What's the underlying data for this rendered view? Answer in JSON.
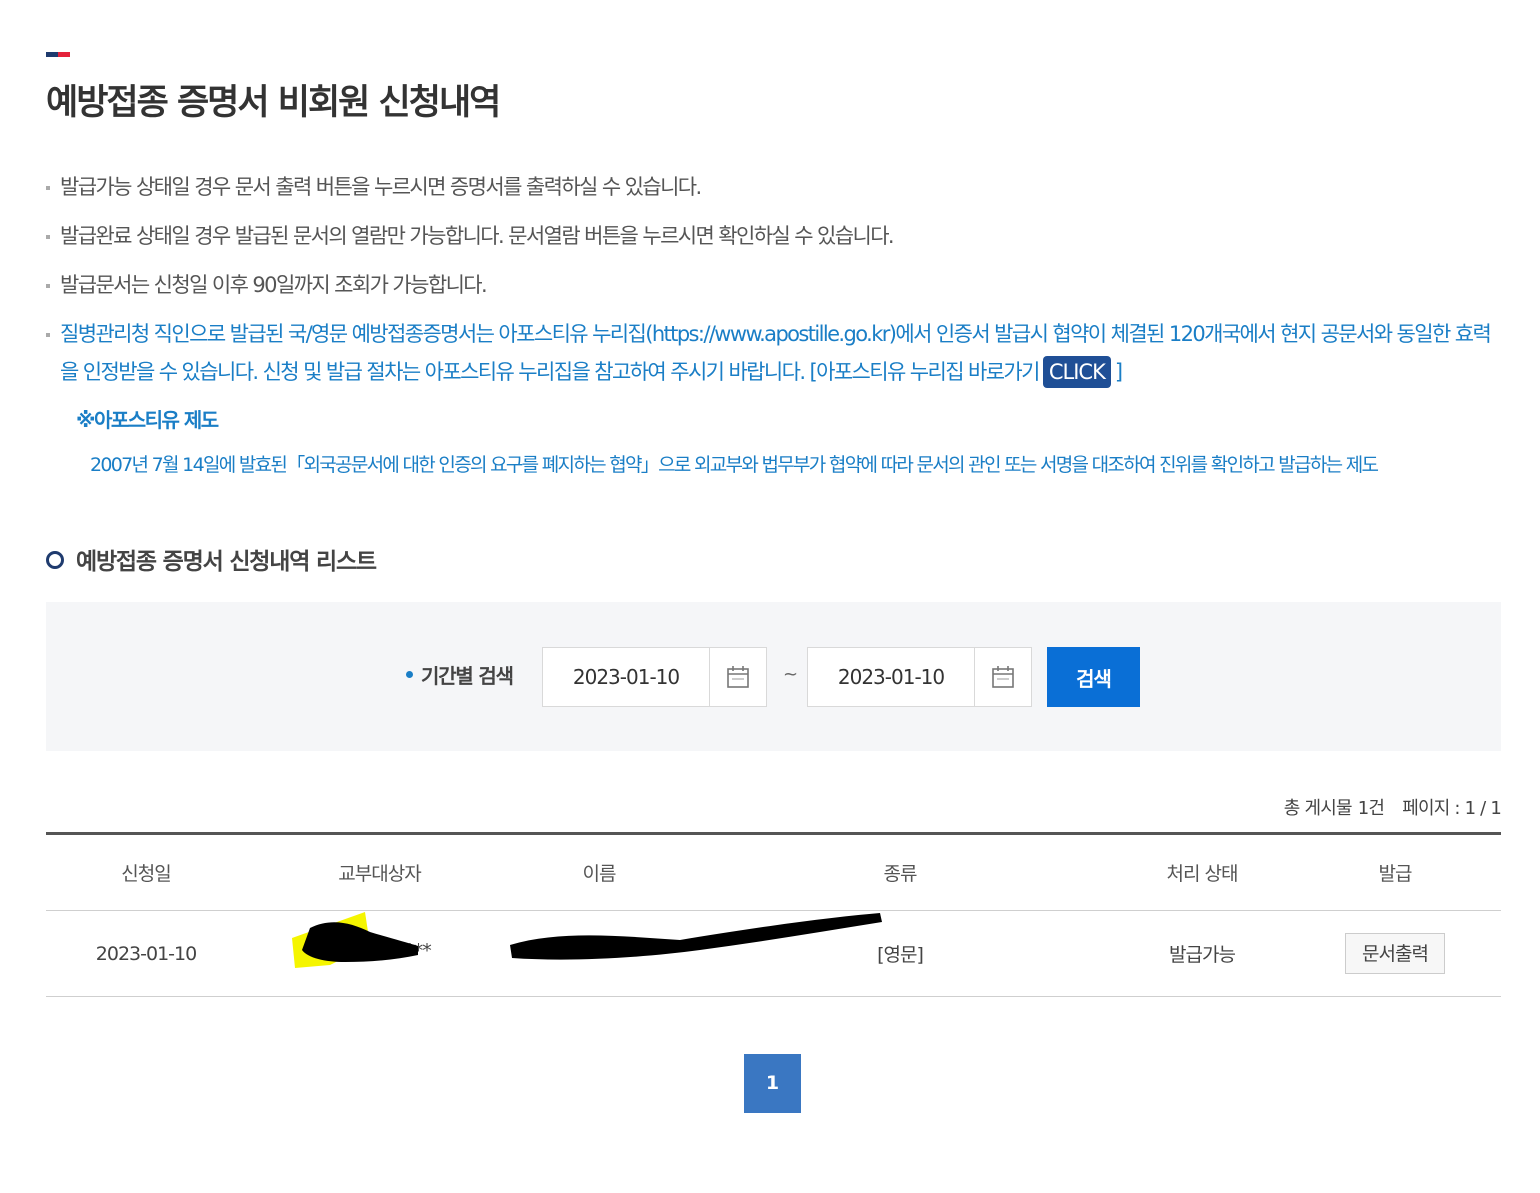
{
  "page": {
    "title": "예방접종 증명서 비회원 신청내역"
  },
  "notices": [
    "발급가능 상태일 경우 문서 출력 버튼을 누르시면 증명서를 출력하실 수 있습니다.",
    "발급완료 상태일 경우 발급된 문서의 열람만 가능합니다. 문서열람 버튼을 누르시면 확인하실 수 있습니다.",
    "발급문서는 신청일 이후 90일까지 조회가 가능합니다."
  ],
  "apostille": {
    "notice_text": "질병관리청 직인으로 발급된 국/영문 예방접종증명서는 아포스티유 누리집(https://www.apostille.go.kr)에서 인증서 발급시 협약이 체결된 120개국에서 현지 공문서와 동일한 효력을 인정받을 수 있습니다. 신청 및 발급 절차는 아포스티유 누리집을 참고하여 주시기 바랍니다. [아포스티유 누리집 바로가기",
    "click_label": "CLICK",
    "closing_bracket": "]",
    "system_title": "※아포스티유 제도",
    "system_desc": "2007년 7월 14일에 발효된「외국공문서에 대한 인증의 요구를 폐지하는 협약」으로 외교부와 법무부가 협약에 따라 문서의 관인 또는 서명을 대조하여 진위를 확인하고 발급하는 제도"
  },
  "section": {
    "title": "예방접종 증명서 신청내역 리스트"
  },
  "search": {
    "label": "기간별 검색",
    "start_date": "2023-01-10",
    "end_date": "2023-01-10",
    "separator": "~",
    "button_label": "검색"
  },
  "meta": {
    "total_label": "총 게시물",
    "total_count": "1건",
    "page_label": "페이지 : 1 / 1"
  },
  "table": {
    "headers": [
      "신청일",
      "교부대상자",
      "이름",
      "종류",
      "처리 상태",
      "발급"
    ],
    "rows": [
      {
        "date": "2023-01-10",
        "recipient": "*****",
        "name": "",
        "type": "[영문]",
        "status": "발급가능",
        "action": "문서출력"
      }
    ]
  },
  "pagination": {
    "current": "1"
  },
  "colors": {
    "accent_blue": "#0a6fd6",
    "notice_blue": "#1a7ec6",
    "navy": "#1f3b6e",
    "red": "#e4223b",
    "page_button": "#3a77c2",
    "redaction_highlight": "#f5f500"
  },
  "icons": {
    "calendar": "calendar-icon"
  }
}
